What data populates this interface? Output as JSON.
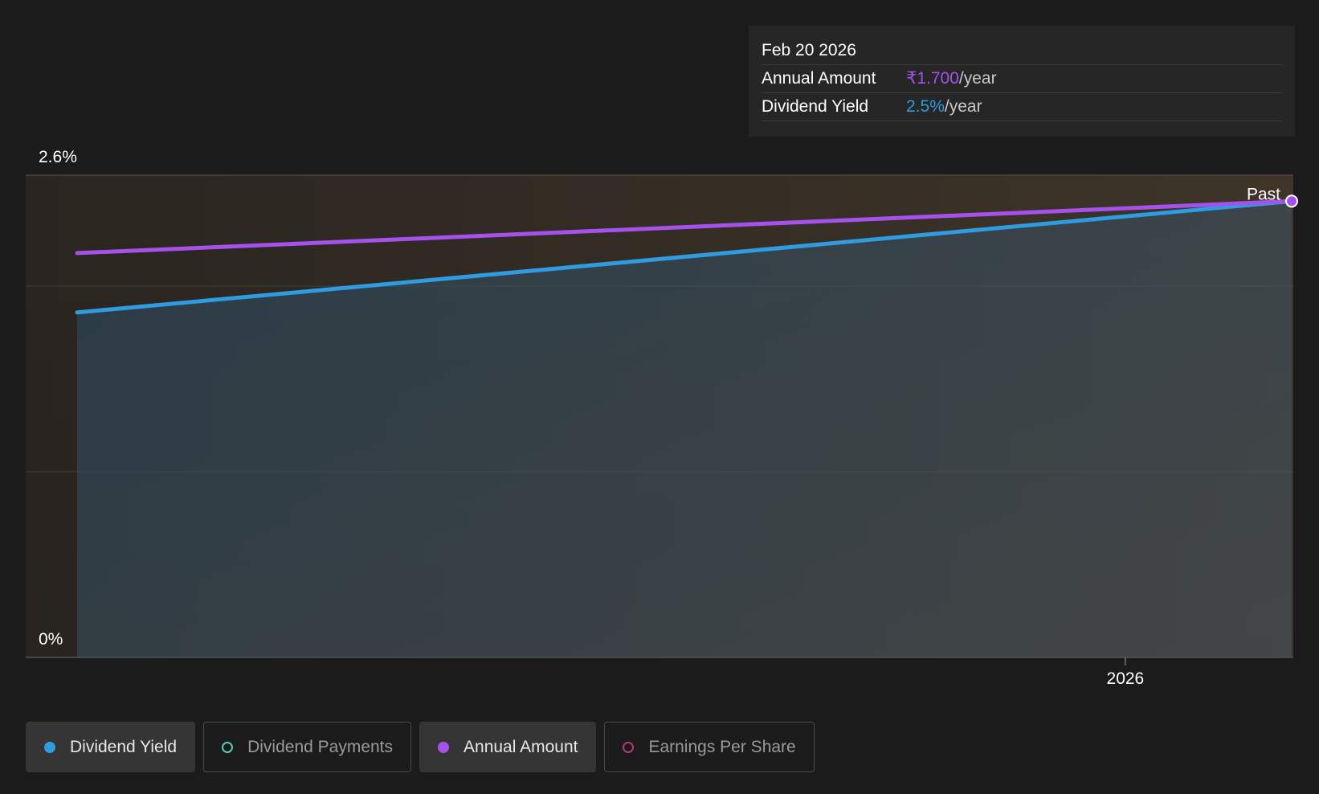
{
  "tooltip": {
    "date": "Feb 20 2026",
    "rows": [
      {
        "label": "Annual Amount",
        "value": "₹1.700",
        "unit": "/year"
      },
      {
        "label": "Dividend Yield",
        "value": "2.5%",
        "unit": "/year"
      }
    ]
  },
  "legend": {
    "items": [
      {
        "label": "Dividend Yield",
        "color": "#2f9be0",
        "active": true
      },
      {
        "label": "Dividend Payments",
        "color": "#5cc8b4",
        "active": false
      },
      {
        "label": "Annual Amount",
        "color": "#a651ec",
        "active": true
      },
      {
        "label": "Earnings Per Share",
        "color": "#b03a78",
        "active": false
      }
    ]
  },
  "chart_data": {
    "type": "line",
    "x": [
      "2025-02-20",
      "2026-02-20"
    ],
    "series": [
      {
        "name": "Dividend Yield",
        "values": [
          1.86,
          2.46
        ],
        "color": "#2f9be0",
        "area": true
      },
      {
        "name": "Annual Amount",
        "values": [
          2.18,
          2.46
        ],
        "color": "#a651ec"
      }
    ],
    "ylim": [
      0,
      2.6
    ],
    "y_tick_labels": [
      "0%",
      "2.6%"
    ],
    "x_tick_labels": [
      {
        "date": "2026-01-01",
        "label": "2026"
      }
    ],
    "marker_label": "Past",
    "grid": true
  }
}
